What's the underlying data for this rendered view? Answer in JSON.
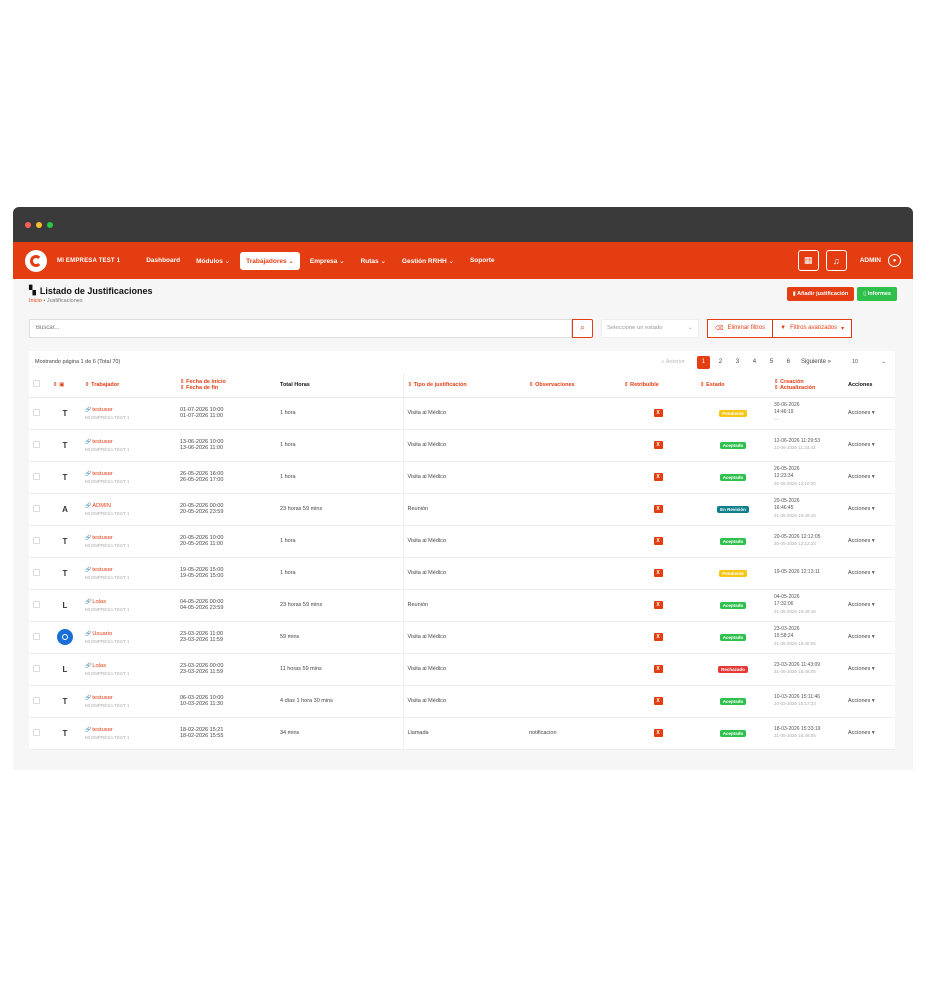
{
  "nav": {
    "brand": "MI EMPRESA TEST 1",
    "items": [
      {
        "label": "Dashboard",
        "chevron": false,
        "active": false
      },
      {
        "label": "Módulos",
        "chevron": true,
        "active": false
      },
      {
        "label": "Trabajadores",
        "chevron": true,
        "active": true
      },
      {
        "label": "Empresa",
        "chevron": true,
        "active": false
      },
      {
        "label": "Rutas",
        "chevron": true,
        "active": false
      },
      {
        "label": "Gestión RRHH",
        "chevron": true,
        "active": false
      },
      {
        "label": "Soporte",
        "chevron": false,
        "active": false
      }
    ],
    "user": "ADMIN"
  },
  "page": {
    "title": "Listado de Justificaciones",
    "breadcrumb_home": "Inicio",
    "breadcrumb_sep": "•",
    "breadcrumb_current": "Justificaciones",
    "add_button": "Añadir justificación",
    "reports_button": "Informes"
  },
  "filters": {
    "search_placeholder": "Buscar...",
    "estado_placeholder": "Seleccione un estado",
    "clear_filters": "Eliminar filtros",
    "advanced_filters": "Filtros avanzados"
  },
  "table": {
    "showing": "Mostrando página 1 de 6 (Total 70)",
    "pagination": {
      "prev": "« Anterior",
      "pages": [
        "1",
        "2",
        "3",
        "4",
        "5",
        "6"
      ],
      "active_page": "1",
      "next": "Siguiente »",
      "page_size": "10"
    },
    "headers": {
      "trabajador": "Trabajador",
      "fecha_inicio": "Fecha de inicio",
      "fecha_fin": "Fecha de fin",
      "total_horas": "Total Horas",
      "tipo": "Tipo de justificación",
      "observaciones": "Observaciones",
      "retribuible": "Retribuible",
      "estado": "Estado",
      "creacion": "Creación",
      "actualizacion": "Actualización",
      "acciones": "Acciones"
    },
    "rows": [
      {
        "initial": "T",
        "avatar": false,
        "name": "testuser",
        "company": "MI EMPRESA TEST 1",
        "start": "01-07-2026 10:00",
        "end": "01-07-2026 11:00",
        "hours": "1 hora",
        "type": "Visita al Médico",
        "obs": "",
        "retrib": "X",
        "status": "Pendiente",
        "status_kind": "pendiente",
        "created": "30-06-2026",
        "created2": "14:46:19",
        "updated": "—",
        "actions": "Acciones"
      },
      {
        "initial": "T",
        "avatar": false,
        "name": "testuser",
        "company": "MI EMPRESA TEST 1",
        "start": "13-06-2026 10:00",
        "end": "13-06-2026 11:00",
        "hours": "1 hora",
        "type": "Visita al Médico",
        "obs": "",
        "retrib": "X",
        "status": "Aceptado",
        "status_kind": "aceptado",
        "created": "12-06-2026 11:29:53",
        "created2": "",
        "updated": "12-06-2026 11:33:42",
        "actions": "Acciones"
      },
      {
        "initial": "T",
        "avatar": false,
        "name": "testuser",
        "company": "MI EMPRESA TEST 1",
        "start": "26-05-2026 16:00",
        "end": "26-05-2026 17:00",
        "hours": "1 hora",
        "type": "Visita al Médico",
        "obs": "",
        "retrib": "X",
        "status": "Aceptado",
        "status_kind": "aceptado",
        "created": "26-05-2026",
        "created2": "12:23:34",
        "updated": "26-05-2026 12:10:20",
        "actions": "Acciones"
      },
      {
        "initial": "A",
        "avatar": false,
        "name": "ADMIN",
        "company": "MI EMPRESA TEST 1",
        "start": "20-05-2026 00:00",
        "end": "20-05-2026 23:59",
        "hours": "23 horas 59 mins",
        "type": "Reunión",
        "obs": "",
        "retrib": "X",
        "status": "En Revisión",
        "status_kind": "revision",
        "created": "20-05-2026",
        "created2": "16:46:45",
        "updated": "21-05-2026 16:49:10",
        "actions": "Acciones"
      },
      {
        "initial": "T",
        "avatar": false,
        "name": "testuser",
        "company": "MI EMPRESA TEST 1",
        "start": "20-05-2026 10:00",
        "end": "20-05-2026 11:00",
        "hours": "1 hora",
        "type": "Visita al Médico",
        "obs": "",
        "retrib": "X",
        "status": "Aceptado",
        "status_kind": "aceptado",
        "created": "20-05-2026 12:12:05",
        "created2": "",
        "updated": "20-05-2026 12:12:23",
        "actions": "Acciones"
      },
      {
        "initial": "T",
        "avatar": false,
        "name": "testuser",
        "company": "MI EMPRESA TEST 1",
        "start": "19-05-2026 15:00",
        "end": "19-05-2026 15:00",
        "hours": "1 hora",
        "type": "Visita al Médico",
        "obs": "",
        "retrib": "X",
        "status": "Pendiente",
        "status_kind": "pendiente",
        "created": "19-05-2026 12:13:11",
        "created2": "",
        "updated": "",
        "actions": "Acciones"
      },
      {
        "initial": "L",
        "avatar": false,
        "name": "Lolas",
        "company": "MI EMPRESA TEST 1",
        "start": "04-05-2026 00:00",
        "end": "04-05-2026 23:59",
        "hours": "23 horas 59 mins",
        "type": "Reunión",
        "obs": "",
        "retrib": "X",
        "status": "Aceptado",
        "status_kind": "aceptado",
        "created": "04-05-2026",
        "created2": "17:32:06",
        "updated": "21-05-2026 16:49:18",
        "actions": "Acciones"
      },
      {
        "initial": "",
        "avatar": true,
        "name": "Usuario",
        "company": "MI EMPRESA TEST 1",
        "start": "23-03-2026 11:00",
        "end": "23-03-2026 11:59",
        "hours": "59 mins",
        "type": "Visita al Médico",
        "obs": "",
        "retrib": "X",
        "status": "Aceptado",
        "status_kind": "aceptado",
        "created": "23-03-2026",
        "created2": "15:58:24",
        "updated": "21-05-2026 16:48:05",
        "actions": "Acciones"
      },
      {
        "initial": "L",
        "avatar": false,
        "name": "Lolas",
        "company": "MI EMPRESA TEST 1",
        "start": "23-03-2026 00:00",
        "end": "23-03-2026 11:59",
        "hours": "11 horas 59 mins",
        "type": "Visita al Médico",
        "obs": "",
        "retrib": "X",
        "status": "Rechazado",
        "status_kind": "rechazado",
        "created": "23-03-2026 11:43:09",
        "created2": "",
        "updated": "21-05-2026 16:48:05",
        "actions": "Acciones"
      },
      {
        "initial": "T",
        "avatar": false,
        "name": "testuser",
        "company": "MI EMPRESA TEST 1",
        "start": "06-03-2026 10:00",
        "end": "10-03-2026 11:30",
        "hours": "4 días 1 hora 30 mins",
        "type": "Visita al Médico",
        "obs": "",
        "retrib": "X",
        "status": "Aceptado",
        "status_kind": "aceptado",
        "created": "10-03-2026 15:11:46",
        "created2": "",
        "updated": "10-03-2026 15:17:23",
        "actions": "Acciones"
      },
      {
        "initial": "T",
        "avatar": false,
        "name": "testuser",
        "company": "MI EMPRESA TEST 1",
        "start": "18-02-2026 15:21",
        "end": "18-02-2026 15:55",
        "hours": "34 mins",
        "type": "Llamada",
        "obs": "notificacion",
        "retrib": "X",
        "status": "Aceptado",
        "status_kind": "aceptado",
        "created": "18-03-2026 15:33:19",
        "created2": "",
        "updated": "21-05-2026 16:49:05",
        "actions": "Acciones"
      }
    ]
  },
  "colors": {
    "brand": "#e43d12",
    "success": "#2ec04b",
    "warning": "#f5c518",
    "info": "#0e7f8c",
    "danger": "#e53935"
  }
}
